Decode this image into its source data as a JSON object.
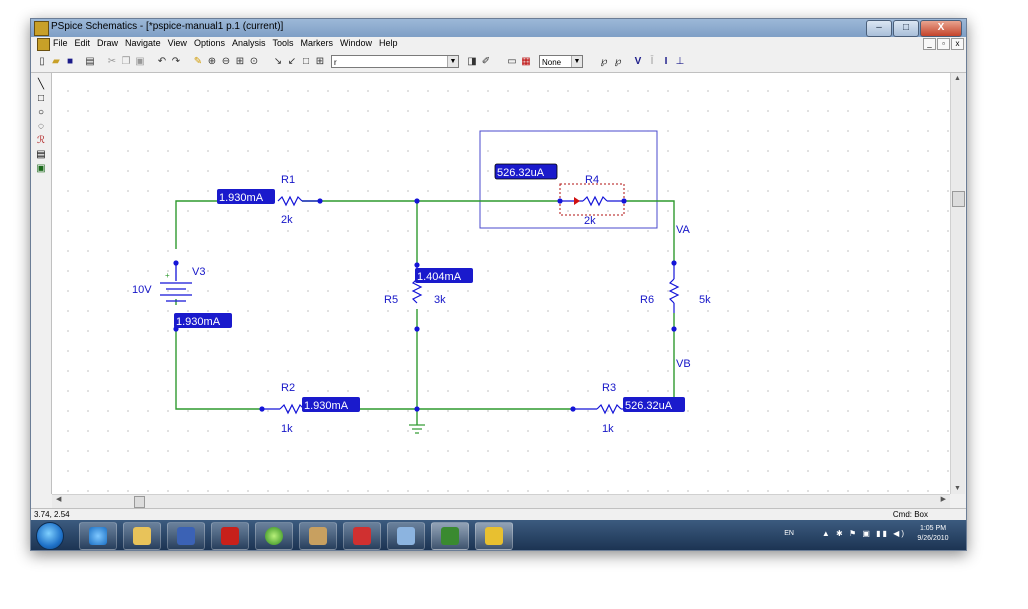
{
  "window": {
    "title": "PSpice Schematics - [*pspice-manual1  p.1 (current)]",
    "controls": {
      "minimize": "–",
      "maximize": "□",
      "close": "X"
    }
  },
  "menu": [
    "File",
    "Edit",
    "Draw",
    "Navigate",
    "View",
    "Options",
    "Analysis",
    "Tools",
    "Markers",
    "Window",
    "Help"
  ],
  "toolbar": {
    "part_combo_value": "r",
    "marker_combo_value": "None"
  },
  "schematic": {
    "components": {
      "R1": {
        "name": "R1",
        "value": "2k"
      },
      "R2": {
        "name": "R2",
        "value": "1k"
      },
      "R3": {
        "name": "R3",
        "value": "1k"
      },
      "R4": {
        "name": "R4",
        "value": "2k"
      },
      "R5": {
        "name": "R5",
        "value": "3k"
      },
      "R6": {
        "name": "R6",
        "value": "5k"
      },
      "V3": {
        "name": "V3",
        "value": "10V",
        "plus": "+"
      }
    },
    "nets": {
      "VA": "VA",
      "VB": "VB"
    },
    "currents": {
      "i_r1": "1.930mA",
      "i_v3": "1.930mA",
      "i_r2": "1.930mA",
      "i_r5": "1.404mA",
      "i_r4": "526.32uA",
      "i_r3": "526.32uA"
    }
  },
  "status": {
    "coords": "3.74,  2.54",
    "cmd": "Cmd: Box"
  },
  "taskbar": {
    "lang": "EN",
    "time": "1:05 PM",
    "date": "9/26/2010",
    "apps": [
      "internet-explorer",
      "file-explorer",
      "word",
      "acrobat",
      "refresh-app",
      "capture-app",
      "schematic-app",
      "paint-app",
      "pspice-app",
      "pspice-schematics"
    ]
  },
  "colors": {
    "wire": "#2f9a2f",
    "label": "#1616c8",
    "badge_bg": "#1a1acc",
    "badge_text": "#ffffff",
    "node": "#1414d8"
  }
}
